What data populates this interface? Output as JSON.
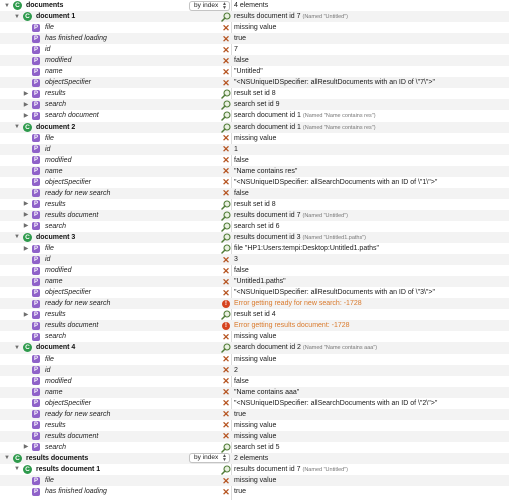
{
  "colors": {
    "class_badge": "#2e9a4c",
    "property_badge": "#8f62c9",
    "x_icon": "#b5531f",
    "error_text": "#d9792b",
    "error_icon": "#d6431f",
    "row_stripe": "#f3f3f3"
  },
  "icons": {
    "class_badge": "C",
    "property_badge": "P",
    "x": "✕",
    "error": "!",
    "expanded": "▼",
    "collapsed": "▶"
  },
  "rows": [
    {
      "depth": 0,
      "disc": "expanded",
      "badge": "class",
      "name": "documents",
      "style": "bold",
      "popup": "by index",
      "icon": null,
      "value": "4 elements",
      "note": ""
    },
    {
      "depth": 1,
      "disc": "expanded",
      "badge": "class",
      "name": "document 1",
      "style": "bold",
      "icon": "mag",
      "value": "results document id 7",
      "note": "(Named \"Untitled\")"
    },
    {
      "depth": 2,
      "disc": null,
      "badge": "prop",
      "name": "file",
      "style": "italic",
      "icon": "x",
      "value": "missing value",
      "note": ""
    },
    {
      "depth": 2,
      "disc": null,
      "badge": "prop",
      "name": "has finished loading",
      "style": "italic",
      "icon": "x",
      "value": "true",
      "note": ""
    },
    {
      "depth": 2,
      "disc": null,
      "badge": "prop",
      "name": "id",
      "style": "italic",
      "icon": "x",
      "value": "7",
      "note": ""
    },
    {
      "depth": 2,
      "disc": null,
      "badge": "prop",
      "name": "modified",
      "style": "italic",
      "icon": "x",
      "value": "false",
      "note": ""
    },
    {
      "depth": 2,
      "disc": null,
      "badge": "prop",
      "name": "name",
      "style": "italic",
      "icon": "x",
      "value": "\"Untitled\"",
      "note": ""
    },
    {
      "depth": 2,
      "disc": null,
      "badge": "prop",
      "name": "objectSpecifier",
      "style": "italic",
      "icon": "x",
      "value": "\"<NSUniqueIDSpecifier: allResultDocuments with an ID of \\\"7\\\">\"",
      "note": ""
    },
    {
      "depth": 2,
      "disc": "collapsed",
      "badge": "prop",
      "name": "results",
      "style": "italic",
      "icon": "mag",
      "value": "result set id 8",
      "note": ""
    },
    {
      "depth": 2,
      "disc": "collapsed",
      "badge": "prop",
      "name": "search",
      "style": "italic",
      "icon": "mag",
      "value": "search set id 9",
      "note": ""
    },
    {
      "depth": 2,
      "disc": "collapsed",
      "badge": "prop",
      "name": "search document",
      "style": "italic",
      "icon": "mag",
      "value": "search document id 1",
      "note": "(Named \"Name contains res\")"
    },
    {
      "depth": 1,
      "disc": "expanded",
      "badge": "class",
      "name": "document 2",
      "style": "bold",
      "icon": "mag",
      "value": "search document id 1",
      "note": "(Named \"Name contains res\")"
    },
    {
      "depth": 2,
      "disc": null,
      "badge": "prop",
      "name": "file",
      "style": "italic",
      "icon": "x",
      "value": "missing value",
      "note": ""
    },
    {
      "depth": 2,
      "disc": null,
      "badge": "prop",
      "name": "id",
      "style": "italic",
      "icon": "x",
      "value": "1",
      "note": ""
    },
    {
      "depth": 2,
      "disc": null,
      "badge": "prop",
      "name": "modified",
      "style": "italic",
      "icon": "x",
      "value": "false",
      "note": ""
    },
    {
      "depth": 2,
      "disc": null,
      "badge": "prop",
      "name": "name",
      "style": "italic",
      "icon": "x",
      "value": "\"Name contains res\"",
      "note": ""
    },
    {
      "depth": 2,
      "disc": null,
      "badge": "prop",
      "name": "objectSpecifier",
      "style": "italic",
      "icon": "x",
      "value": "\"<NSUniqueIDSpecifier: allSearchDocuments with an ID of \\\"1\\\">\"",
      "note": ""
    },
    {
      "depth": 2,
      "disc": null,
      "badge": "prop",
      "name": "ready for new search",
      "style": "italic",
      "icon": "x",
      "value": "false",
      "note": ""
    },
    {
      "depth": 2,
      "disc": "collapsed",
      "badge": "prop",
      "name": "results",
      "style": "italic",
      "icon": "mag",
      "value": "result set id 8",
      "note": ""
    },
    {
      "depth": 2,
      "disc": "collapsed",
      "badge": "prop",
      "name": "results document",
      "style": "italic",
      "icon": "mag",
      "value": "results document id 7",
      "note": "(Named \"Untitled\")"
    },
    {
      "depth": 2,
      "disc": "collapsed",
      "badge": "prop",
      "name": "search",
      "style": "italic",
      "icon": "mag",
      "value": "search set id 6",
      "note": ""
    },
    {
      "depth": 1,
      "disc": "expanded",
      "badge": "class",
      "name": "document 3",
      "style": "bold",
      "icon": "mag",
      "value": "results document id 3",
      "note": "(Named \"Untitled1.paths\")"
    },
    {
      "depth": 2,
      "disc": "collapsed",
      "badge": "prop",
      "name": "file",
      "style": "italic",
      "icon": "mag",
      "value": "file \"HP1:Users:tempi:Desktop:Untitled1.paths\"",
      "note": ""
    },
    {
      "depth": 2,
      "disc": null,
      "badge": "prop",
      "name": "id",
      "style": "italic",
      "icon": "x",
      "value": "3",
      "note": ""
    },
    {
      "depth": 2,
      "disc": null,
      "badge": "prop",
      "name": "modified",
      "style": "italic",
      "icon": "x",
      "value": "false",
      "note": ""
    },
    {
      "depth": 2,
      "disc": null,
      "badge": "prop",
      "name": "name",
      "style": "italic",
      "icon": "x",
      "value": "\"Untitled1.paths\"",
      "note": ""
    },
    {
      "depth": 2,
      "disc": null,
      "badge": "prop",
      "name": "objectSpecifier",
      "style": "italic",
      "icon": "x",
      "value": "\"<NSUniqueIDSpecifier: allResultDocuments with an ID of \\\"3\\\">\"",
      "note": ""
    },
    {
      "depth": 2,
      "disc": null,
      "badge": "prop",
      "name": "ready for new search",
      "style": "italic",
      "icon": "err",
      "value": "Error getting ready for new search: -1728",
      "note": ""
    },
    {
      "depth": 2,
      "disc": "collapsed",
      "badge": "prop",
      "name": "results",
      "style": "italic",
      "icon": "mag",
      "value": "result set id 4",
      "note": ""
    },
    {
      "depth": 2,
      "disc": null,
      "badge": "prop",
      "name": "results document",
      "style": "italic",
      "icon": "err",
      "value": "Error getting results document: -1728",
      "note": ""
    },
    {
      "depth": 2,
      "disc": null,
      "badge": "prop",
      "name": "search",
      "style": "italic",
      "icon": "x",
      "value": "missing value",
      "note": ""
    },
    {
      "depth": 1,
      "disc": "expanded",
      "badge": "class",
      "name": "document 4",
      "style": "bold",
      "icon": "mag",
      "value": "search document id 2",
      "note": "(Named \"Name contains aaa\")"
    },
    {
      "depth": 2,
      "disc": null,
      "badge": "prop",
      "name": "file",
      "style": "italic",
      "icon": "x",
      "value": "missing value",
      "note": ""
    },
    {
      "depth": 2,
      "disc": null,
      "badge": "prop",
      "name": "id",
      "style": "italic",
      "icon": "x",
      "value": "2",
      "note": ""
    },
    {
      "depth": 2,
      "disc": null,
      "badge": "prop",
      "name": "modified",
      "style": "italic",
      "icon": "x",
      "value": "false",
      "note": ""
    },
    {
      "depth": 2,
      "disc": null,
      "badge": "prop",
      "name": "name",
      "style": "italic",
      "icon": "x",
      "value": "\"Name contains aaa\"",
      "note": ""
    },
    {
      "depth": 2,
      "disc": null,
      "badge": "prop",
      "name": "objectSpecifier",
      "style": "italic",
      "icon": "x",
      "value": "\"<NSUniqueIDSpecifier: allSearchDocuments with an ID of \\\"2\\\">\"",
      "note": ""
    },
    {
      "depth": 2,
      "disc": null,
      "badge": "prop",
      "name": "ready for new search",
      "style": "italic",
      "icon": "x",
      "value": "true",
      "note": ""
    },
    {
      "depth": 2,
      "disc": null,
      "badge": "prop",
      "name": "results",
      "style": "italic",
      "icon": "x",
      "value": "missing value",
      "note": ""
    },
    {
      "depth": 2,
      "disc": null,
      "badge": "prop",
      "name": "results document",
      "style": "italic",
      "icon": "x",
      "value": "missing value",
      "note": ""
    },
    {
      "depth": 2,
      "disc": "collapsed",
      "badge": "prop",
      "name": "search",
      "style": "italic",
      "icon": "mag",
      "value": "search set id 5",
      "note": ""
    },
    {
      "depth": 0,
      "disc": "expanded",
      "badge": "class",
      "name": "results documents",
      "style": "bold",
      "popup": "by index",
      "icon": null,
      "value": "2 elements",
      "note": ""
    },
    {
      "depth": 1,
      "disc": "expanded",
      "badge": "class",
      "name": "results document 1",
      "style": "bold",
      "icon": "mag",
      "value": "results document id 7",
      "note": "(Named \"Untitled\")"
    },
    {
      "depth": 2,
      "disc": null,
      "badge": "prop",
      "name": "file",
      "style": "italic",
      "icon": "x",
      "value": "missing value",
      "note": ""
    },
    {
      "depth": 2,
      "disc": null,
      "badge": "prop",
      "name": "has finished loading",
      "style": "italic",
      "icon": "x",
      "value": "true",
      "note": ""
    }
  ]
}
